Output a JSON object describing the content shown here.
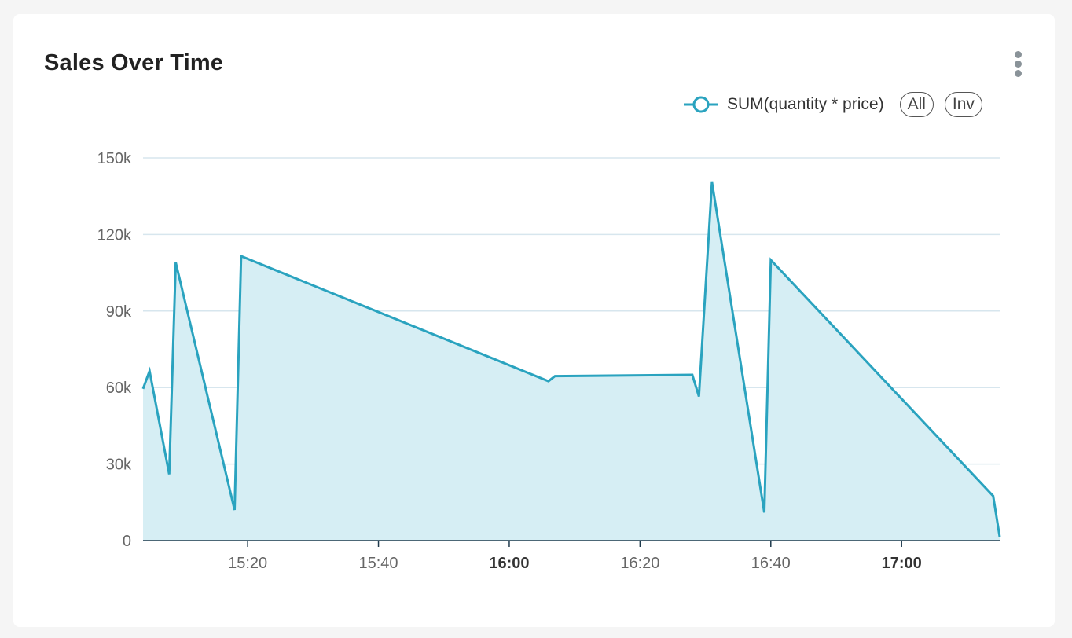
{
  "card": {
    "title": "Sales Over Time",
    "menu_icon": "more-vertical-icon"
  },
  "legend": {
    "series_label": "SUM(quantity * price)",
    "all_label": "All",
    "inv_label": "Inv"
  },
  "colors": {
    "line": "#2aa3bf",
    "area": "#d6eef4",
    "grid": "#d7e6ee",
    "axis": "#1f3a4d"
  },
  "chart_data": {
    "type": "area",
    "title": "Sales Over Time",
    "xlabel": "",
    "ylabel": "",
    "ylim": [
      0,
      150000
    ],
    "yticks": [
      0,
      30000,
      60000,
      90000,
      120000,
      150000
    ],
    "ytick_labels": [
      "0",
      "30k",
      "60k",
      "90k",
      "120k",
      "150k"
    ],
    "xlim": [
      "15:04",
      "17:15"
    ],
    "xticks": [
      "15:20",
      "15:40",
      "16:00",
      "16:20",
      "16:40",
      "17:00"
    ],
    "xtick_labels": [
      "15:20",
      "15:40",
      "16:00",
      "16:20",
      "16:40",
      "17:00"
    ],
    "xtick_bold": [
      "16:00",
      "17:00"
    ],
    "grid": true,
    "legend_position": "top-right",
    "series": [
      {
        "name": "SUM(quantity * price)",
        "x": [
          "15:04",
          "15:05",
          "15:08",
          "15:09",
          "15:18",
          "15:19",
          "16:06",
          "16:07",
          "16:28",
          "16:29",
          "16:31",
          "16:39",
          "16:40",
          "17:14",
          "17:15"
        ],
        "y": [
          59500,
          66500,
          26000,
          109000,
          12000,
          111500,
          62500,
          64500,
          65000,
          56500,
          140500,
          11000,
          110000,
          17500,
          1500
        ]
      }
    ]
  }
}
